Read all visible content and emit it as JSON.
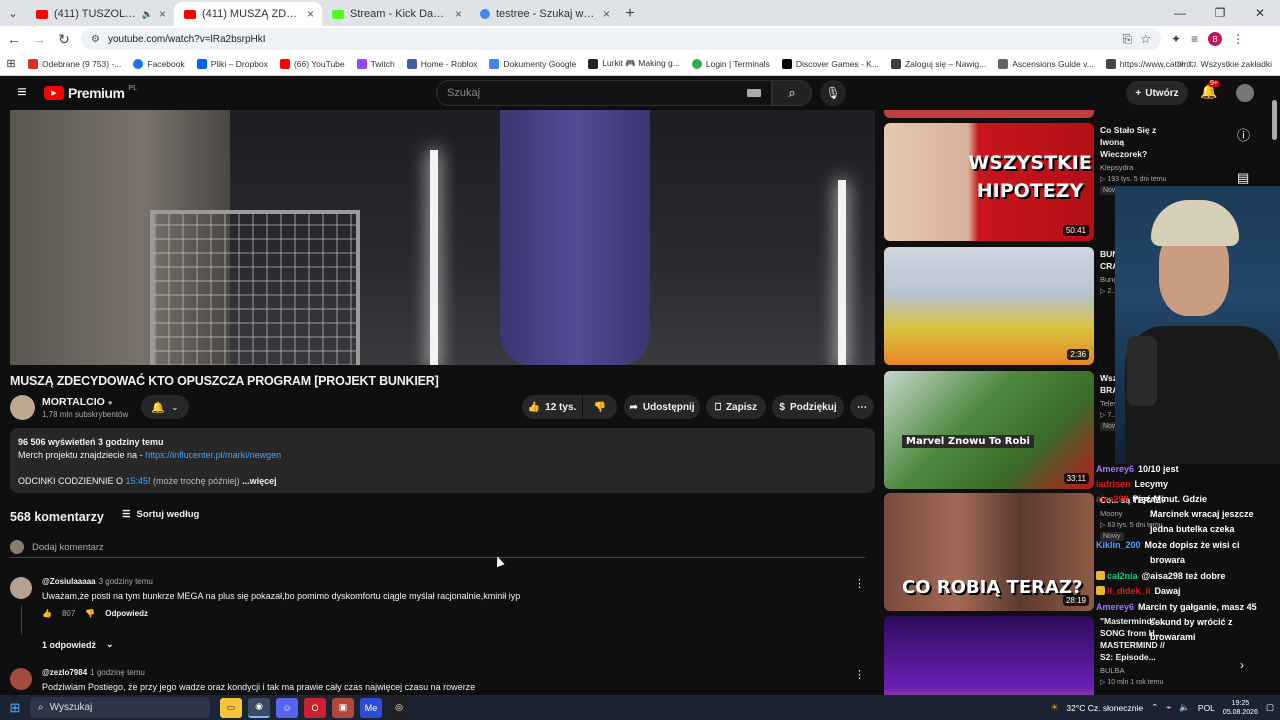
{
  "browser": {
    "tabs": [
      {
        "title": "(411) TUSZOL & WRONEK",
        "color": "#ff0000",
        "audio": true
      },
      {
        "title": "(411) MUSZĄ ZDECYDOWAĆ KTO",
        "color": "#ff0000",
        "active": true
      },
      {
        "title": "Stream - Kick Dashboard",
        "color": "#53fc18"
      },
      {
        "title": "testree - Szukaj w Google",
        "color": "#4285f4"
      }
    ],
    "url": "youtube.com/watch?v=lRa2bsrpHkI",
    "profile_initial": "B"
  },
  "bookmarks": {
    "items": [
      {
        "label": "Odebrane (9 753) -...",
        "color": "#d93025"
      },
      {
        "label": "Facebook",
        "color": "#1877f2"
      },
      {
        "label": "Pliki – Dropbox",
        "color": "#0061ff"
      },
      {
        "label": "(66) YouTube",
        "color": "#ff0000"
      },
      {
        "label": "Twitch",
        "color": "#9146ff"
      },
      {
        "label": "Home - Roblox",
        "color": "#3b5fa8"
      },
      {
        "label": "Dokumenty Google",
        "color": "#4285f4"
      },
      {
        "label": "Lurkit 🎮 Making g...",
        "color": "#222222"
      },
      {
        "label": "Login | Terminals",
        "color": "#34a853"
      },
      {
        "label": "Discover Games - K...",
        "color": "#000000"
      },
      {
        "label": "Zaloguj się – Nawig...",
        "color": "#3c4043"
      },
      {
        "label": "Ascensions Guide v...",
        "color": "#5f6368"
      },
      {
        "label": "https://www.catbird...",
        "color": "#444444"
      }
    ],
    "more": "»",
    "folder": "Wszystkie zakładki"
  },
  "youtube": {
    "logo": "Premium",
    "logo_region": "PL",
    "search_placeholder": "Szukaj",
    "create_label": "Utwórz",
    "notif_badge": "9+"
  },
  "video": {
    "title": "MUSZĄ ZDECYDOWAĆ KTO OPUSZCZA PROGRAM [PROJEKT BUNKIER]",
    "channel": "MORTALCIO",
    "subscribers": "1,78 mln subskrybentów",
    "likes": "12 tys.",
    "share_label": "Udostępnij",
    "save_label": "Zapisz",
    "thanks_label": "Podziękuj",
    "desc_meta": "96 506 wyświetleń  3 godziny temu",
    "desc_merch": "Merch projektu znajdziecie na - ",
    "desc_link": "https://influcenter.pl/marki/newgen",
    "desc_line3_a": "ODCINKI CODZIENNIE O ",
    "desc_time": "15:45",
    "desc_line3_b": "! (może trochę później)",
    "desc_more": "...więcej"
  },
  "comments": {
    "count": "568 komentarzy",
    "sort_label": "Sortuj według",
    "add_placeholder": "Dodaj komentarz",
    "items": [
      {
        "user": "@Zosiulaaaaa",
        "time": "3 godziny temu",
        "text": "Uważam,że posti na tym bunkrze MEGA na plus się pokazał,bo pomimo dyskomfortu ciągle myślał racjonalnie,kminił iyp",
        "likes": "807",
        "reply": "Odpowiedz",
        "replies": "1 odpowiedź"
      },
      {
        "user": "@zezlo7984",
        "time": "1 godzinę temu",
        "text": "Podziwiam Postiego, że przy jego wadze oraz kondycji i tak ma prawie cały czas najwięcej czasu na rowerze"
      }
    ]
  },
  "recommended": [
    {
      "title": "Co Stało Się z Iwoną Wieczorek?",
      "channel": "Klepsydra",
      "meta": "▷ 193 tys.  5 dni temu",
      "badge": "Nowy",
      "duration": "50:41",
      "thumb_text": "WSZYSTKIE HIPOTEZY"
    },
    {
      "title": "BUN... AUT... CRA...",
      "channel": "Bung...",
      "meta": "▷ 2...",
      "duration": "2:36",
      "thumb_text": ""
    },
    {
      "title": "Wsz... prze... BRA...",
      "channel": "Telev...",
      "meta": "▷ 7...",
      "badge": "Now",
      "duration": "33:11",
      "thumb_text": "Marvel Znowu To Robi"
    },
    {
      "title": "Co... są TERAZ?",
      "channel": "Moony",
      "meta": "▷ 63 tys.  5 dni temu",
      "badge": "Nowy",
      "duration": "28:19",
      "thumb_text": "CO ROBIĄ TERAZ?"
    },
    {
      "title": "\"Mastermind\" ... SONG from H... MASTERMIND // S2: Episode...",
      "channel": "BULBA",
      "meta": "▷ 10 mln  1 rok temu",
      "duration": "",
      "thumb_text": ""
    }
  ],
  "chat": [
    {
      "user": "Amerey6",
      "ucolor": "#a970ff",
      "msg": "10/10 jest"
    },
    {
      "user": "iadrisen",
      "ucolor": "#e91916",
      "msg": "Lecymy"
    },
    {
      "user": "aisa298",
      "ucolor": "#e91916",
      "msg": "Pięć Minut. Gdzie"
    },
    {
      "user": "",
      "ucolor": "#ffffff",
      "msg": "Marcinek wracaj jeszcze"
    },
    {
      "user": "",
      "ucolor": "#ffffff",
      "msg": "jedna butelka czeka"
    },
    {
      "user": "Kiklin_200",
      "ucolor": "#4ea1ff",
      "msg": "Może dopisz że wisi ci"
    },
    {
      "user": "",
      "ucolor": "#ffffff",
      "msg": "browara"
    },
    {
      "user": "cal2nia",
      "ucolor": "#00d084",
      "msg": "@aisa298 też dobre"
    },
    {
      "user": "il_didek_il",
      "ucolor": "#e91916",
      "msg": "Dawaj"
    },
    {
      "user": "Amerey6",
      "ucolor": "#a970ff",
      "msg": "Marcin ty gałganie, masz 45"
    },
    {
      "user": "",
      "ucolor": "#ffffff",
      "msg": "sekund by wrócić z"
    },
    {
      "user": "",
      "ucolor": "#ffffff",
      "msg": "browarami"
    }
  ],
  "taskbar": {
    "search": "Wyszukaj",
    "weather": "32°C  Cz. słonecznie",
    "lang": "POL",
    "time": "19:25",
    "date": "05.08.2026"
  }
}
